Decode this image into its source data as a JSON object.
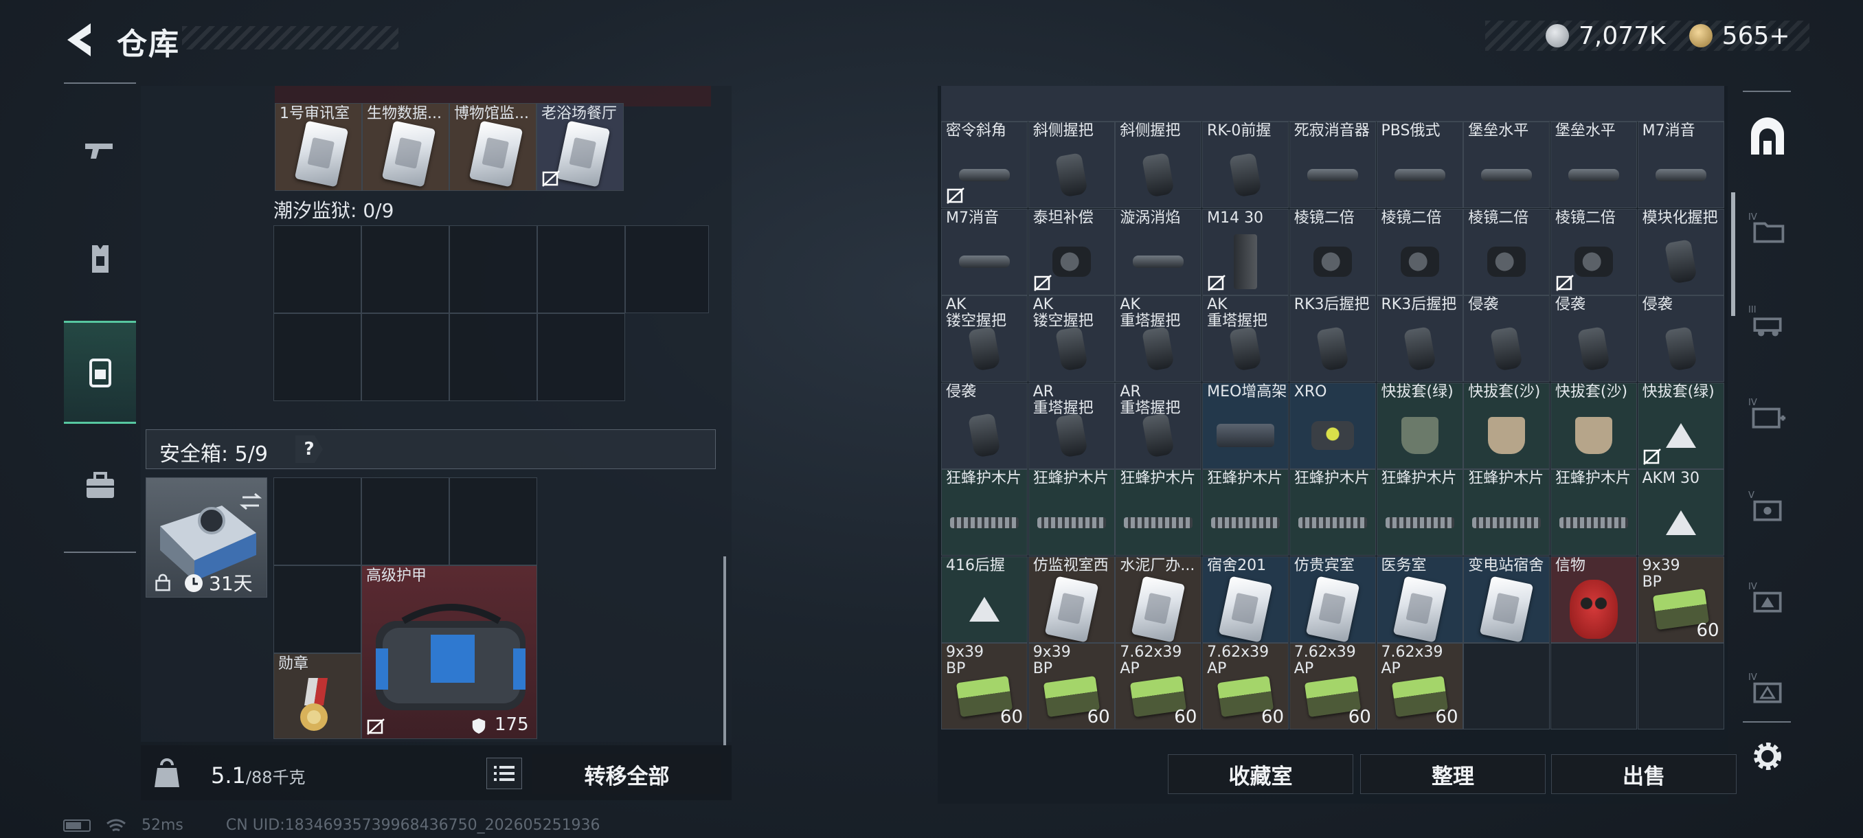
{
  "header": {
    "title": "仓库",
    "currency": [
      {
        "icon": "silver-coin-icon",
        "amount": "7,077K"
      },
      {
        "icon": "gold-coin-icon",
        "amount": "565+"
      }
    ]
  },
  "left_rail": {
    "tabs": [
      {
        "icon": "gun-icon"
      },
      {
        "icon": "armor-vest-icon"
      },
      {
        "icon": "backpack-icon",
        "active": true
      },
      {
        "icon": "briefcase-icon"
      }
    ]
  },
  "left_panel": {
    "keycards": [
      {
        "label": "1号审讯室"
      },
      {
        "label": "生物数据..."
      },
      {
        "label": "博物馆监..."
      },
      {
        "label": "老浴场餐厅",
        "no_take_out": true
      }
    ],
    "prison_label": "潮汐监狱: 0/9",
    "safebox_label": "安全箱: 5/9",
    "help": "?",
    "safebox_days": "31天",
    "medal_label": "勋章",
    "armor_label": "高级护甲",
    "armor_value": "175",
    "weight_main": "5.1",
    "weight_rest": "/88千克",
    "transfer_all": "转移全部"
  },
  "right_grid": {
    "rows": [
      [
        {
          "label": "密令斜角",
          "bg": "gray",
          "icon": "attach",
          "noout": true
        },
        {
          "label": "斜侧握把",
          "bg": "gray",
          "icon": "grip"
        },
        {
          "label": "斜侧握把",
          "bg": "gray",
          "icon": "grip"
        },
        {
          "label": "RK-0前握",
          "bg": "gray",
          "icon": "grip"
        },
        {
          "label": "死寂消音器",
          "bg": "gray",
          "icon": "attach"
        },
        {
          "label": "PBS俄式",
          "bg": "gray",
          "icon": "attach"
        },
        {
          "label": "堡垒水平",
          "bg": "gray",
          "icon": "attach"
        },
        {
          "label": "堡垒水平",
          "bg": "gray",
          "icon": "attach"
        },
        {
          "label": "M7消音",
          "bg": "gray",
          "icon": "attach"
        }
      ],
      [
        {
          "label": "M7消音",
          "bg": "gray",
          "icon": "attach"
        },
        {
          "label": "泰坦补偿",
          "bg": "gray",
          "icon": "scope",
          "noout": true
        },
        {
          "label": "漩涡消焰",
          "bg": "gray",
          "icon": "attach"
        },
        {
          "label": "M14 30",
          "bg": "gray",
          "icon": "mag",
          "noout": true
        },
        {
          "label": "棱镜二倍",
          "bg": "gray",
          "icon": "scope"
        },
        {
          "label": "棱镜二倍",
          "bg": "gray",
          "icon": "scope"
        },
        {
          "label": "棱镜二倍",
          "bg": "gray",
          "icon": "scope"
        },
        {
          "label": "棱镜二倍",
          "bg": "gray",
          "icon": "scope",
          "noout": true
        },
        {
          "label": "模块化握把",
          "bg": "gray",
          "icon": "grip"
        }
      ],
      [
        {
          "label": "AK\n镂空握把",
          "bg": "gray",
          "icon": "grip"
        },
        {
          "label": "AK\n镂空握把",
          "bg": "gray",
          "icon": "grip"
        },
        {
          "label": "AK\n重塔握把",
          "bg": "gray",
          "icon": "grip"
        },
        {
          "label": "AK\n重塔握把",
          "bg": "gray",
          "icon": "grip"
        },
        {
          "label": "RK3后握把",
          "bg": "gray",
          "icon": "grip"
        },
        {
          "label": "RK3后握把",
          "bg": "gray",
          "icon": "grip"
        },
        {
          "label": "侵袭",
          "bg": "gray",
          "icon": "grip"
        },
        {
          "label": "侵袭",
          "bg": "gray",
          "icon": "grip"
        },
        {
          "label": "侵袭",
          "bg": "gray",
          "icon": "grip"
        }
      ],
      [
        {
          "label": "侵袭",
          "bg": "gray",
          "icon": "grip"
        },
        {
          "label": "AR\n重塔握把",
          "bg": "gray",
          "icon": "grip"
        },
        {
          "label": "AR\n重塔握把",
          "bg": "gray",
          "icon": "grip"
        },
        {
          "label": "MEO增高架",
          "bg": "blue",
          "icon": "mount"
        },
        {
          "label": "XRO",
          "bg": "blue",
          "icon": "redsight"
        },
        {
          "label": "快拔套(绿)",
          "bg": "teal",
          "icon": "holster-g"
        },
        {
          "label": "快拔套(沙)",
          "bg": "teal",
          "icon": "holster-s"
        },
        {
          "label": "快拔套(沙)",
          "bg": "teal",
          "icon": "holster-s"
        },
        {
          "label": "快拔套(绿)",
          "bg": "teal",
          "icon": "tri",
          "noout": true
        }
      ],
      [
        {
          "label": "狂蜂护木片",
          "bg": "teal",
          "icon": "rail"
        },
        {
          "label": "狂蜂护木片",
          "bg": "teal",
          "icon": "rail"
        },
        {
          "label": "狂蜂护木片",
          "bg": "teal",
          "icon": "rail"
        },
        {
          "label": "狂蜂护木片",
          "bg": "teal",
          "icon": "rail"
        },
        {
          "label": "狂蜂护木片",
          "bg": "teal",
          "icon": "rail"
        },
        {
          "label": "狂蜂护木片",
          "bg": "teal",
          "icon": "rail"
        },
        {
          "label": "狂蜂护木片",
          "bg": "teal",
          "icon": "rail"
        },
        {
          "label": "狂蜂护木片",
          "bg": "teal",
          "icon": "rail"
        },
        {
          "label": "AKM 30",
          "bg": "teal",
          "icon": "tri"
        }
      ],
      [
        {
          "label": "416后握",
          "bg": "teal",
          "icon": "tri"
        },
        {
          "label": "仿监视室西",
          "bg": "brown",
          "icon": "card"
        },
        {
          "label": "水泥厂办...",
          "bg": "brown",
          "icon": "card"
        },
        {
          "label": "宿舍201",
          "bg": "blue",
          "icon": "card"
        },
        {
          "label": "仿贵宾室",
          "bg": "blue",
          "icon": "card"
        },
        {
          "label": "医务室",
          "bg": "blue",
          "icon": "card"
        },
        {
          "label": "变电站宿舍",
          "bg": "blue",
          "icon": "card"
        },
        {
          "label": "信物",
          "bg": "red",
          "icon": "mask"
        },
        {
          "label": "9x39\nBP",
          "bg": "brown",
          "icon": "ammo",
          "qty": "60"
        }
      ],
      [
        {
          "label": "9x39\nBP",
          "bg": "brown",
          "icon": "ammo",
          "qty": "60"
        },
        {
          "label": "9x39\nBP",
          "bg": "brown",
          "icon": "ammo",
          "qty": "60"
        },
        {
          "label": "7.62x39\nAP",
          "bg": "brown",
          "icon": "ammo",
          "qty": "60"
        },
        {
          "label": "7.62x39\nAP",
          "bg": "brown",
          "icon": "ammo",
          "qty": "60"
        },
        {
          "label": "7.62x39\nAP",
          "bg": "brown",
          "icon": "ammo",
          "qty": "60"
        },
        {
          "label": "7.62x39\nAP",
          "bg": "brown",
          "icon": "ammo",
          "qty": "60"
        },
        {
          "label": "",
          "bg": "dark"
        },
        {
          "label": "",
          "bg": "dark"
        },
        {
          "label": "",
          "bg": "dark"
        }
      ]
    ]
  },
  "right_buttons": {
    "collection": "收藏室",
    "organize": "整理",
    "sell": "出售"
  },
  "right_rail": {
    "tabs": [
      {
        "icon": "all-items-icon"
      },
      {
        "icon": "folder-tier4-icon"
      },
      {
        "icon": "vehicle-tier3-icon"
      },
      {
        "icon": "medkit-tier4-icon"
      },
      {
        "icon": "gear-tier5-icon"
      },
      {
        "icon": "helmet-tier4-icon"
      },
      {
        "icon": "misc-tier4-icon"
      }
    ]
  },
  "statusbar": {
    "ping": "52ms",
    "uid": "CN UID:18346935739968436750_202605251936"
  }
}
